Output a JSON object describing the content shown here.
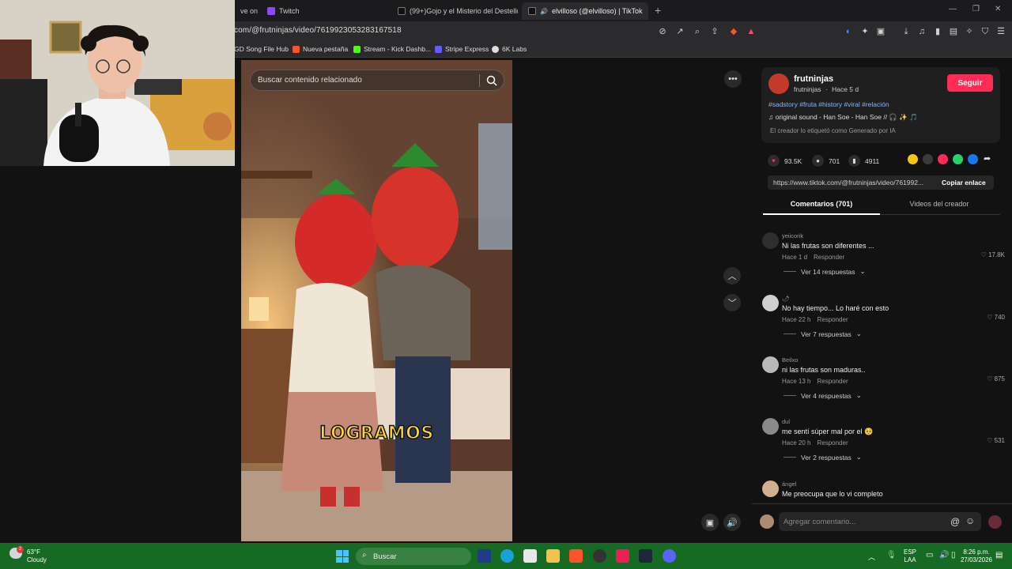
{
  "browser": {
    "tabs": [
      {
        "label": "ve on"
      },
      {
        "label": "Twitch"
      },
      {
        "label": "(99+)Gojo y el Misterio del Destello"
      },
      {
        "label": "elvilloso (@elvilloso) | TikTok"
      }
    ],
    "url": "com/@frutninjas/video/7619923053283167518",
    "bookmarks": [
      "GD Song File Hub",
      "Nueva pestaña",
      "Stream - Kick Dashb...",
      "Stripe Express",
      "6K Labs"
    ]
  },
  "video": {
    "search_placeholder": "Buscar contenido relacionado",
    "caption": "LOGRAMOS"
  },
  "creator": {
    "name": "frutninjas",
    "handle": "frutninjas",
    "posted": "Hace 5 d",
    "follow_label": "Seguir",
    "hashtags": "#sadstory #fruta #history #viral #relación",
    "sound": "original sound - Han Soe - Han Soe",
    "ai_label": "El creador lo etiquetó como Generado por IA"
  },
  "stats": {
    "likes": "93.5K",
    "comments": "701",
    "saves": "4911"
  },
  "link": {
    "url": "https://www.tiktok.com/@frutninjas/video/761992...",
    "copy_label": "Copiar enlace"
  },
  "panel_tabs": {
    "comments": "Comentarios (701)",
    "creator_videos": "Videos del creador"
  },
  "comments": [
    {
      "user": "yeiicorik",
      "text": "Ni las frutas son diferentes ...",
      "time": "Hace 1 d",
      "reply": "Responder",
      "likes": "17.8K",
      "replies": "Ver 14 respuestas"
    },
    {
      "user": "🌶",
      "text": "No hay tiempo... Lo haré con esto",
      "time": "Hace 22 h",
      "reply": "Responder",
      "likes": "740",
      "replies": "Ver 7 respuestas"
    },
    {
      "user": "Beilxo",
      "text": "ni las frutas son maduras..",
      "time": "Hace 13 h",
      "reply": "Responder",
      "likes": "875",
      "replies": "Ver 4 respuestas"
    },
    {
      "user": "dul",
      "text": "me sentí súper mal por el 🥺",
      "time": "Hace 20 h",
      "reply": "Responder",
      "likes": "531",
      "replies": "Ver 2 respuestas"
    },
    {
      "user": "ángel",
      "text": "Me preocupa que lo vi completo",
      "time": "",
      "reply": "",
      "likes": "",
      "replies": ""
    }
  ],
  "add_comment_placeholder": "Agregar comentario...",
  "taskbar": {
    "weather_temp": "63°F",
    "weather_desc": "Cloudy",
    "search_label": "Buscar",
    "lang": "ESP",
    "lang2": "LAA",
    "time": "8:26 p.m.",
    "date": "27/03/2026",
    "weather_badge": "2"
  }
}
